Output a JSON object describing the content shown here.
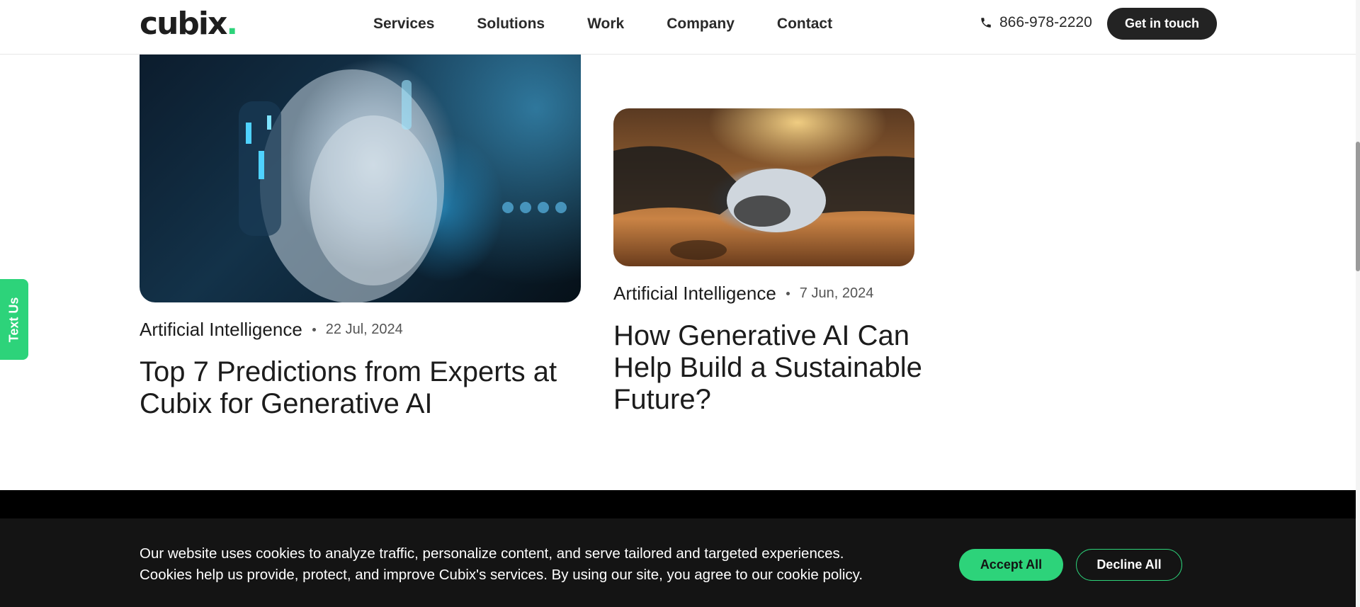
{
  "header": {
    "logo_text": "cubix",
    "logo_dot": ".",
    "nav": [
      "Services",
      "Solutions",
      "Work",
      "Company",
      "Contact"
    ],
    "phone_icon": "phone-icon",
    "phone": "866-978-2220",
    "cta_label": "Get in touch"
  },
  "side_tab": {
    "label": "Text Us"
  },
  "posts": [
    {
      "image_icon": "ai-humanoid-face-image",
      "category": "Artificial Intelligence",
      "date": "22 Jul, 2024",
      "title_line1": "Top 7 Predictions from Experts at",
      "title_line2": "Cubix for Generative AI"
    },
    {
      "image_icon": "robot-human-handshake-image",
      "category": "Artificial Intelligence",
      "date": "7 Jun, 2024",
      "title_line1": "How Generative AI Can",
      "title_line2": "Help Build a Sustainable",
      "title_line3": "Future?"
    }
  ],
  "cookie": {
    "line1": "Our website uses cookies to analyze traffic, personalize content, and serve tailored and targeted experiences.",
    "line2": "Cookies help us provide, protect, and improve Cubix's services. By using our site, you agree to our cookie policy.",
    "accept_label": "Accept All",
    "decline_label": "Decline All"
  },
  "colors": {
    "accent": "#2dd37a",
    "dark": "#232323",
    "banner": "#141414"
  }
}
